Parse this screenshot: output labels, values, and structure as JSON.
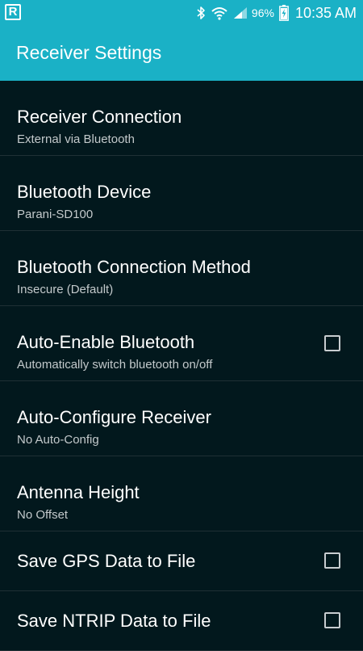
{
  "status_bar": {
    "app_icon_letter": "R",
    "battery": "96%",
    "time": "10:35 AM"
  },
  "app_bar": {
    "title": "Receiver Settings"
  },
  "settings": [
    {
      "title": "Receiver Connection",
      "summary": "External via Bluetooth"
    },
    {
      "title": "Bluetooth Device",
      "summary": "Parani-SD100"
    },
    {
      "title": "Bluetooth Connection Method",
      "summary": "Insecure (Default)"
    },
    {
      "title": "Auto-Enable Bluetooth",
      "summary": "Automatically switch bluetooth on/off",
      "checked": false
    },
    {
      "title": "Auto-Configure Receiver",
      "summary": "No Auto-Config"
    },
    {
      "title": "Antenna Height",
      "summary": "No Offset"
    },
    {
      "title": "Save GPS Data to File",
      "checked": false
    },
    {
      "title": "Save NTRIP Data to File",
      "checked": false
    }
  ],
  "colors": {
    "accent": "#1ab1c6",
    "background": "#02181d",
    "divider": "#1f3035",
    "summary_text": "#c3c9cb"
  }
}
